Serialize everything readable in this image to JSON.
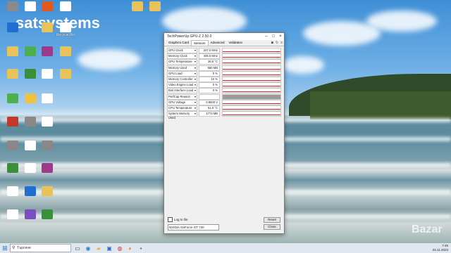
{
  "watermark": "satsystems",
  "brand_watermark": "Bazar",
  "desktop_icons": [
    {
      "label": "",
      "color": "#8a8a8a"
    },
    {
      "label": "",
      "color": "#ffffff"
    },
    {
      "label": "",
      "color": "#e05a1f"
    },
    {
      "label": "",
      "color": "#ffffff"
    },
    {
      "label": "",
      "color": "#e8c35a"
    },
    {
      "label": "",
      "color": "#e8c35a"
    },
    {
      "label": "",
      "color": "#1f6fd0"
    },
    {
      "label": "",
      "color": "#e8c35a"
    },
    {
      "label": "Recycle Bin",
      "color": "#ffffff"
    },
    {
      "label": "",
      "color": "#e8c35a"
    },
    {
      "label": "",
      "color": "#4caf50"
    },
    {
      "label": "",
      "color": "#9c3b8a"
    },
    {
      "label": "",
      "color": "#e8c35a"
    },
    {
      "label": "",
      "color": "#e8c35a"
    },
    {
      "label": "",
      "color": "#3a8f3a"
    },
    {
      "label": "",
      "color": "#ffffff"
    },
    {
      "label": "",
      "color": "#e8c35a"
    },
    {
      "label": "",
      "color": "#4caf50"
    },
    {
      "label": "",
      "color": "#f0c040"
    },
    {
      "label": "",
      "color": "#ffffff"
    },
    {
      "label": "",
      "color": "#c0392b"
    },
    {
      "label": "",
      "color": "#888888"
    },
    {
      "label": "",
      "color": "#ffffff"
    },
    {
      "label": "",
      "color": "#888888"
    },
    {
      "label": "",
      "color": "#ffffff"
    },
    {
      "label": "",
      "color": "#888888"
    },
    {
      "label": "",
      "color": "#3a8f3a"
    },
    {
      "label": "",
      "color": "#ffffff"
    },
    {
      "label": "",
      "color": "#9c3b8a"
    },
    {
      "label": "",
      "color": "#ffffff"
    },
    {
      "label": "",
      "color": "#1f6fd0"
    },
    {
      "label": "",
      "color": "#e8c35a"
    },
    {
      "label": "",
      "color": "#ffffff"
    },
    {
      "label": "",
      "color": "#7a4fbf"
    },
    {
      "label": "",
      "color": "#3a8f3a"
    }
  ],
  "window": {
    "title": "TechPowerUp GPU-Z 2.50.0",
    "tabs": [
      "Graphics Card",
      "Sensors",
      "Advanced",
      "Validation"
    ],
    "active_tab": "Sensors",
    "rows": [
      {
        "name": "GPU Clock",
        "value": "207.0 MHz"
      },
      {
        "name": "Memory Clock",
        "value": "405.0 MHz"
      },
      {
        "name": "GPU Temperature",
        "value": "36.0 °C"
      },
      {
        "name": "Memory Used",
        "value": "550 MB"
      },
      {
        "name": "GPU Load",
        "value": "0 %"
      },
      {
        "name": "Memory Controller Load",
        "value": "10 %"
      },
      {
        "name": "Video Engine Load",
        "value": "0 %"
      },
      {
        "name": "Bus Interface Load",
        "value": "0 %"
      },
      {
        "name": "PerfCap Reason",
        "value": ""
      },
      {
        "name": "GPU Voltage",
        "value": "0.8000 V"
      },
      {
        "name": "CPU Temperature",
        "value": "51.0 °C"
      },
      {
        "name": "System Memory Used",
        "value": "4773 MB"
      }
    ],
    "log_label": "Log to file",
    "reset_label": "Reset",
    "gpu_select": "NVIDIA GeForce GT 730",
    "close_label": "Close"
  },
  "taskbar": {
    "search_placeholder": "Търсене",
    "time": "7:46",
    "date": "24.11.2023"
  }
}
